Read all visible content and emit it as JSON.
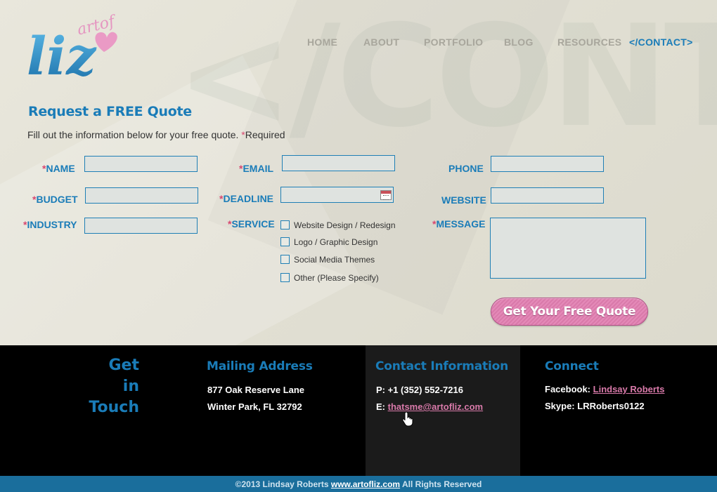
{
  "brand": {
    "logo_word": "liz",
    "logo_small": "artof"
  },
  "watermark": "</CONT",
  "nav": {
    "items": [
      {
        "label": "HOME"
      },
      {
        "label": "ABOUT"
      },
      {
        "label": "PORTFOLIO"
      },
      {
        "label": "BLOG"
      },
      {
        "label": "RESOURCES"
      },
      {
        "label": "</CONTACT>"
      }
    ],
    "active": "</CONTACT>"
  },
  "form": {
    "title": "Request a FREE Quote",
    "subtitle": "Fill out the information below for your free quote.",
    "required_marker": "*",
    "required_text": "Required",
    "labels": {
      "name": "NAME",
      "email": "EMAIL",
      "phone": "PHONE",
      "budget": "BUDGET",
      "deadline": "DEADLINE",
      "website": "WEBSITE",
      "industry": "INDUSTRY",
      "service": "SERVICE",
      "message": "MESSAGE"
    },
    "values": {
      "name": "",
      "email": "",
      "phone": "",
      "budget": "",
      "deadline": "",
      "website": "",
      "industry": "",
      "message": ""
    },
    "services": [
      {
        "label": "Website Design / Redesign",
        "checked": false
      },
      {
        "label": "Logo / Graphic Design",
        "checked": false
      },
      {
        "label": "Social Media Themes",
        "checked": false
      },
      {
        "label": "Other (Please Specify)",
        "checked": false
      }
    ],
    "submit_label": "Get Your Free Quote"
  },
  "footer": {
    "get_in_touch": [
      "Get",
      "in",
      "Touch"
    ],
    "mailing": {
      "heading": "Mailing Address",
      "line1": "877 Oak Reserve Lane",
      "line2": "Winter Park, FL 32792"
    },
    "contact": {
      "heading": "Contact Information",
      "phone_prefix": "P:",
      "phone": "+1 (352) 552-7216",
      "email_prefix": "E:",
      "email": "thatsme@artofliz.com"
    },
    "connect": {
      "heading": "Connect",
      "facebook_prefix": "Facebook:",
      "facebook": "Lindsay Roberts",
      "skype_prefix": "Skype:",
      "skype": "LRRoberts0122"
    },
    "copyright": "©2013 Lindsay Roberts",
    "site_url": "www.artofliz.com",
    "rights": "All Rights Reserved"
  },
  "colors": {
    "accent_blue": "#1a7cb8",
    "accent_pink": "#d8476f",
    "button_pink": "#e489b8",
    "footer_bg": "#000000",
    "bottom_bar": "#1a6e9c"
  }
}
